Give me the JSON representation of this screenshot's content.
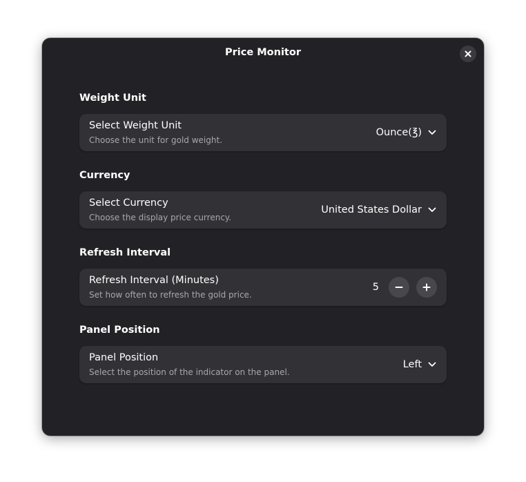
{
  "window": {
    "title": "Price Monitor"
  },
  "groups": {
    "weight": {
      "heading": "Weight Unit",
      "row_title": "Select Weight Unit",
      "row_subtitle": "Choose the unit for gold weight.",
      "selected": "Ounce(℥)"
    },
    "currency": {
      "heading": "Currency",
      "row_title": "Select Currency",
      "row_subtitle": "Choose the display price currency.",
      "selected": "United States Dollar"
    },
    "refresh": {
      "heading": "Refresh Interval",
      "row_title": "Refresh Interval (Minutes)",
      "row_subtitle": "Set how often to refresh the gold price.",
      "value": "5"
    },
    "panel": {
      "heading": "Panel Position",
      "row_title": "Panel Position",
      "row_subtitle": "Select the position of the indicator on the panel.",
      "selected": "Left"
    }
  },
  "icons": {
    "close": "close-icon",
    "dropdown": "chevron-down-icon",
    "decrement": "minus-icon",
    "increment": "plus-icon"
  },
  "colors": {
    "window_bg": "#222226",
    "row_bg": "#323236",
    "button_bg": "#48484c",
    "subtitle": "#a8a8ab"
  }
}
